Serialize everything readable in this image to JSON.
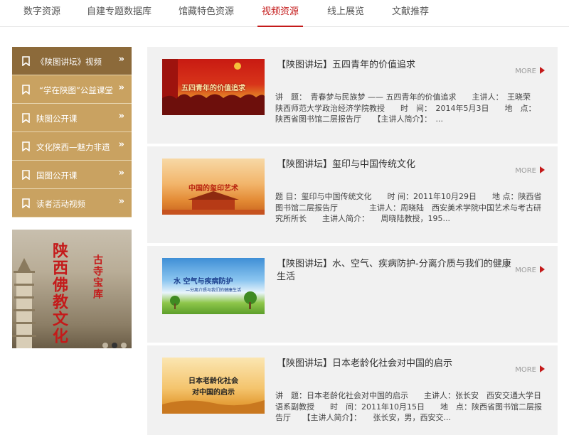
{
  "topnav": {
    "tabs": [
      {
        "label": "数字资源"
      },
      {
        "label": "自建专题数据库"
      },
      {
        "label": "馆藏特色资源"
      },
      {
        "label": "视频资源",
        "active": true
      },
      {
        "label": "线上展览"
      },
      {
        "label": "文献推荐"
      }
    ]
  },
  "sidebar": {
    "items": [
      {
        "label": "《陕图讲坛》视频",
        "chevron": "»",
        "active": true
      },
      {
        "label": "“学在陕图”公益课堂",
        "chevron": "»"
      },
      {
        "label": "陕图公开课",
        "chevron": "»"
      },
      {
        "label": "文化陕西—魅力非遗",
        "chevron": "»"
      },
      {
        "label": "国图公开课",
        "chevron": "»"
      },
      {
        "label": "读者活动视频",
        "chevron": "»"
      }
    ],
    "banner": {
      "main_text": "陕西佛教文化",
      "side_text": "古寺宝库"
    }
  },
  "colors": {
    "accent": "#c41a1a",
    "sidebar_active": "#8c6a3a",
    "sidebar": "#c9a261",
    "card_bg": "#f1f1f1"
  },
  "videos": [
    {
      "title": "【陕图讲坛】五四青年的价值追求",
      "more": "MORE",
      "thumb_text": "五四青年的价值追求",
      "desc": "讲　题：　青春梦与民族梦 —— 五四青年的价值追求　　主讲人：　王晓荣　陕西师范大学政治经济学院教授　　时　间：　2014年5月3日　　地　点：　陕西省图书馆二层报告厅　　【主讲人简介】：　..."
    },
    {
      "title": "【陕图讲坛】玺印与中国传统文化",
      "more": "MORE",
      "thumb_text": "中国的玺印艺术",
      "desc": "题 目：玺印与中国传统文化　　时 间：2011年10月29日　　地 点：陕西省图书馆二层报告厅　　　　主讲人：周晓陆　西安美术学院中国艺术与考古研究所所长　　主讲人简介：　　周晓陆教授，195..."
    },
    {
      "title": "【陕图讲坛】水、空气、疾病防护-分离介质与我们的健康生活",
      "more": "MORE",
      "thumb_text": "水 空气与疾病防护",
      "thumb_sub": "—分离介质与我们的健康生活",
      "desc": ""
    },
    {
      "title": "【陕图讲坛】日本老龄化社会对中国的启示",
      "more": "MORE",
      "thumb_text": "日本老龄化社会",
      "thumb_text2": "对中国的启示",
      "desc": "讲　题：日本老龄化社会对中国的启示　　主讲人：张长安　西安交通大学日语系副教授　　时　间：2011年10月15日　　地　点：陕西省图书馆二层报告厅　　【主讲人简介】：　　张长安，男，西安交..."
    }
  ]
}
